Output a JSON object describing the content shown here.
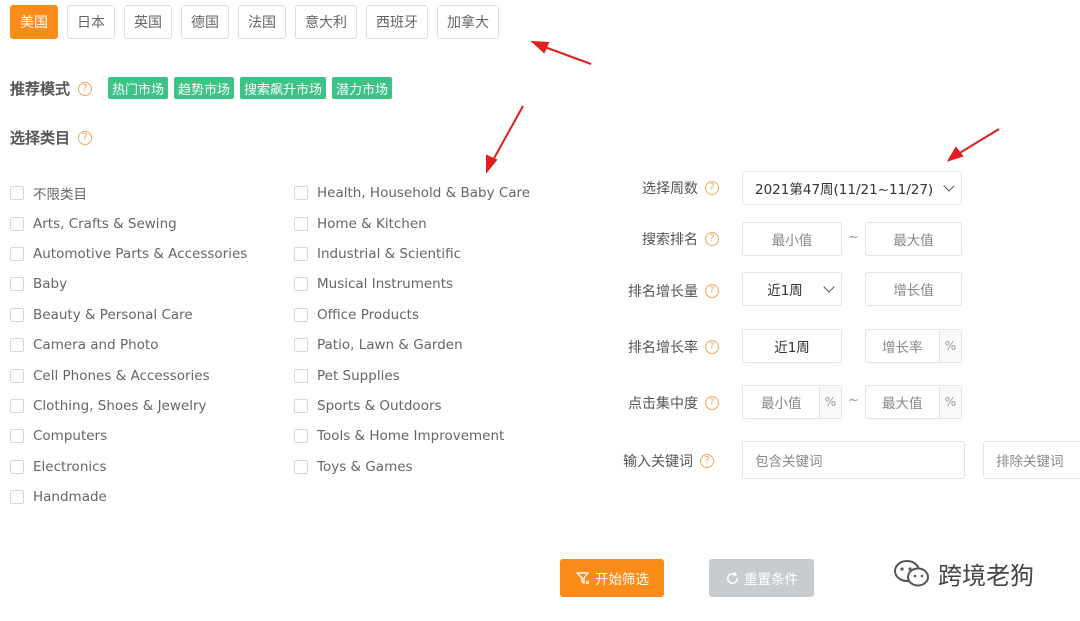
{
  "countries": [
    {
      "label": "美国",
      "active": true
    },
    {
      "label": "日本",
      "active": false
    },
    {
      "label": "英国",
      "active": false
    },
    {
      "label": "德国",
      "active": false
    },
    {
      "label": "法国",
      "active": false
    },
    {
      "label": "意大利",
      "active": false
    },
    {
      "label": "西班牙",
      "active": false
    },
    {
      "label": "加拿大",
      "active": false
    }
  ],
  "recommend": {
    "label": "推荐模式",
    "tags": [
      "热门市场",
      "趋势市场",
      "搜索飙升市场",
      "潜力市场"
    ]
  },
  "category": {
    "label": "选择类目",
    "col1": [
      "不限类目",
      "Arts, Crafts & Sewing",
      "Automotive Parts & Accessories",
      "Baby",
      "Beauty & Personal Care",
      "Camera and Photo",
      "Cell Phones & Accessories",
      "Clothing, Shoes & Jewelry",
      "Computers",
      "Electronics",
      "Handmade"
    ],
    "col2": [
      "Health, Household & Baby Care",
      "Home & Kitchen",
      "Industrial & Scientific",
      "Musical Instruments",
      "Office Products",
      "Patio, Lawn & Garden",
      "Pet Supplies",
      "Sports & Outdoors",
      "Tools & Home Improvement",
      "Toys & Games"
    ]
  },
  "filters": {
    "week": {
      "label": "选择周数",
      "value": "2021第47周(11/21~11/27)"
    },
    "search_rank": {
      "label": "搜索排名",
      "min_placeholder": "最小值",
      "max_placeholder": "最大值",
      "dash": "~"
    },
    "rank_growth": {
      "label": "排名增长量",
      "period": "近1周",
      "placeholder": "增长值"
    },
    "rank_growth_rate": {
      "label": "排名增长率",
      "period": "近1周",
      "placeholder": "增长率",
      "unit": "%"
    },
    "click_concentration": {
      "label": "点击集中度",
      "min_placeholder": "最小值",
      "max_placeholder": "最大值",
      "unit": "%",
      "dash": "~"
    },
    "keywords": {
      "label": "输入关键词",
      "include_placeholder": "包含关键词",
      "exclude_placeholder": "排除关键词"
    }
  },
  "buttons": {
    "start": "开始筛选",
    "reset": "重置条件"
  },
  "watermark": {
    "text": "跨境老狗"
  },
  "colors": {
    "accent": "#fb8c1a",
    "tag": "#3cc487",
    "arrow": "#e02020",
    "disabled": "#c8cbd0"
  },
  "help_icon_glyph": "?"
}
